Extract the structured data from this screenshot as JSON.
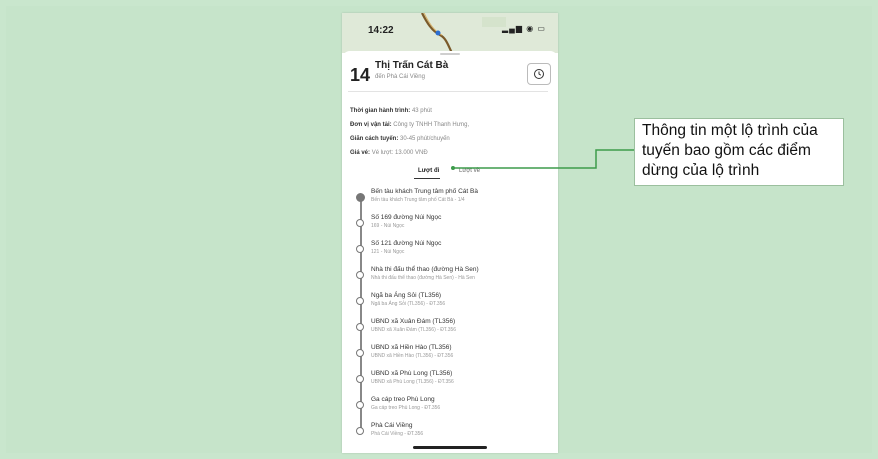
{
  "status": {
    "time": "14:22",
    "icons": "▂▄▆ ◉ ▭"
  },
  "route": {
    "number": "14",
    "title": "Thị Trấn Cát Bà",
    "subtitle": "đến Phà Cái Viềng"
  },
  "info": [
    {
      "label": "Thời gian hành trình:",
      "value": "43 phút"
    },
    {
      "label": "Đơn vị vận tải:",
      "value": "Công ty TNHH Thanh Hưng,"
    },
    {
      "label": "Giãn cách tuyến:",
      "value": "30-45 phút/chuyến"
    },
    {
      "label": "Giá vé:",
      "value": "Vé lượt: 13.000 VNĐ"
    }
  ],
  "tabs": {
    "outbound": "Lượt đi",
    "return": "Lượt về"
  },
  "stops": [
    {
      "name": "Bến tàu khách Trung tâm phố Cát Bà",
      "detail": "Bến tàu khách Trung tâm phố Cát Bà - 1/4"
    },
    {
      "name": "Số 169 đường Núi Ngọc",
      "detail": "169 - Núi Ngọc"
    },
    {
      "name": "Số 121 đường Núi Ngọc",
      "detail": "121 - Núi Ngọc"
    },
    {
      "name": "Nhà thi đấu thể thao (đường Hà Sen)",
      "detail": "Nhà thi đấu thể thao (đường Hà Sen) - Hà Sen"
    },
    {
      "name": "Ngã ba Áng Sỏi (TL356)",
      "detail": "Ngã ba Áng Sỏi (TL356) - ĐT.356"
    },
    {
      "name": "UBND xã Xuân Đám (TL356)",
      "detail": "UBND xã Xuân Đám (TL356) - ĐT.356"
    },
    {
      "name": "UBND xã Hiền Hào (TL356)",
      "detail": "UBND xã Hiền Hào (TL356) - ĐT.356"
    },
    {
      "name": "UBND xã Phù Long (TL356)",
      "detail": "UBND xã Phù Long (TL356) - ĐT.356"
    },
    {
      "name": "Ga cáp treo Phù Long",
      "detail": "Ga cáp treo Phù Long - ĐT.356"
    },
    {
      "name": "Phà Cái Viềng",
      "detail": "Phà Cái Viềng - ĐT.356"
    }
  ],
  "callout": {
    "text": "Thông tin một lộ trình của tuyến bao gồm các điểm dừng của lộ trình"
  },
  "colors": {
    "background": "#c6e4ca",
    "connector": "#3d9b4b"
  }
}
